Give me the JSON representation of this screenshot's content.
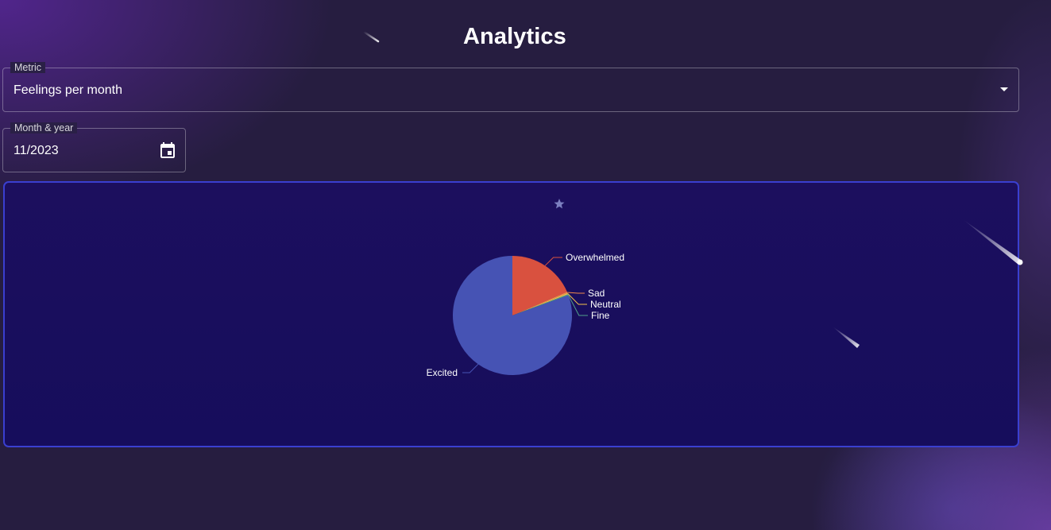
{
  "page": {
    "title": "Analytics"
  },
  "metric": {
    "label": "Metric",
    "value": "Feelings per month"
  },
  "date": {
    "label": "Month & year",
    "value": "11/2023"
  },
  "icons": {
    "dropdown": "chevron-down-icon",
    "calendar": "calendar-icon",
    "decorations": [
      "star-icon",
      "shooting-star-icon"
    ]
  },
  "colors": {
    "panel_border": "#3a3fd0",
    "panel_background": "#160d5c"
  },
  "chart_data": {
    "type": "pie",
    "slices": [
      {
        "label": "Excited",
        "value": 80.5,
        "color": "#4653b4"
      },
      {
        "label": "Overwhelmed",
        "value": 18.5,
        "color": "#d9513f"
      },
      {
        "label": "Sad",
        "value": 0.35,
        "color": "#f08a4b"
      },
      {
        "label": "Neutral",
        "value": 0.35,
        "color": "#f3c14a"
      },
      {
        "label": "Fine",
        "value": 0.3,
        "color": "#4fa08b"
      }
    ],
    "legend": "none"
  }
}
